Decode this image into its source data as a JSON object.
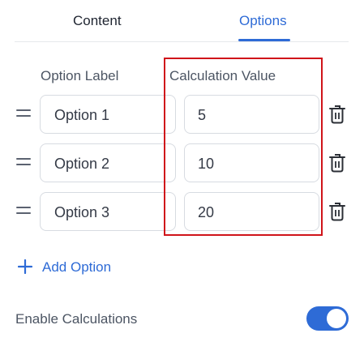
{
  "tabs": [
    {
      "label": "Content",
      "active": false
    },
    {
      "label": "Options",
      "active": true
    }
  ],
  "columns": {
    "option_label": "Option Label",
    "calculation_value": "Calculation Value"
  },
  "options": [
    {
      "label": "Option 1",
      "value": "5"
    },
    {
      "label": "Option 2",
      "value": "10"
    },
    {
      "label": "Option 3",
      "value": "20"
    }
  ],
  "add_option_label": "Add Option",
  "enable_calculations": {
    "label": "Enable Calculations",
    "enabled": true
  },
  "colors": {
    "accent": "#2e6bd6",
    "highlight_border": "#d0141a"
  },
  "icons": {
    "drag": "drag-handle-icon",
    "delete": "trash-icon",
    "add": "plus-icon"
  }
}
